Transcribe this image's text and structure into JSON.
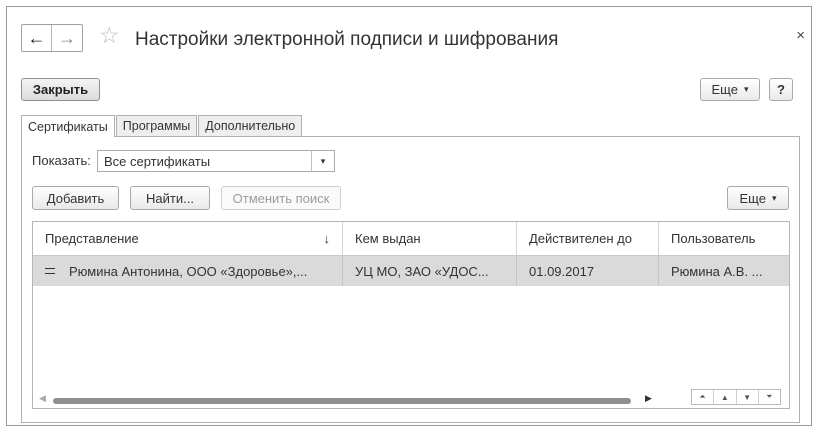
{
  "window": {
    "title": "Настройки электронной подписи и шифрования",
    "close_glyph": "×",
    "back_glyph": "←",
    "forward_glyph": "→",
    "favorite_glyph": "☆"
  },
  "commandbar": {
    "close_label": "Закрыть",
    "more_label": "Еще",
    "help_label": "?"
  },
  "tabs": [
    {
      "label": "Сертификаты",
      "active": true
    },
    {
      "label": "Программы",
      "active": false
    },
    {
      "label": "Дополнительно",
      "active": false
    }
  ],
  "filter": {
    "label": "Показать:",
    "value": "Все сертификаты"
  },
  "toolbar": {
    "add_label": "Добавить",
    "find_label": "Найти...",
    "cancel_search_label": "Отменить поиск",
    "more_label": "Еще"
  },
  "table": {
    "columns": [
      "Представление",
      "Кем выдан",
      "Действителен до",
      "Пользователь"
    ],
    "sort_indicator": "↓",
    "rows": [
      {
        "presentation": "Рюмина Антонина, ООО «Здоровье»,...",
        "issued_by": "УЦ МО, ЗАО «УДОС...",
        "valid_to": "01.09.2017",
        "user": "Рюмина А.В. ..."
      }
    ]
  },
  "icons": {
    "dropdown": "▾",
    "nav_first": "⏶",
    "nav_prev": "▲",
    "nav_next": "▼",
    "nav_last": "⏷"
  }
}
